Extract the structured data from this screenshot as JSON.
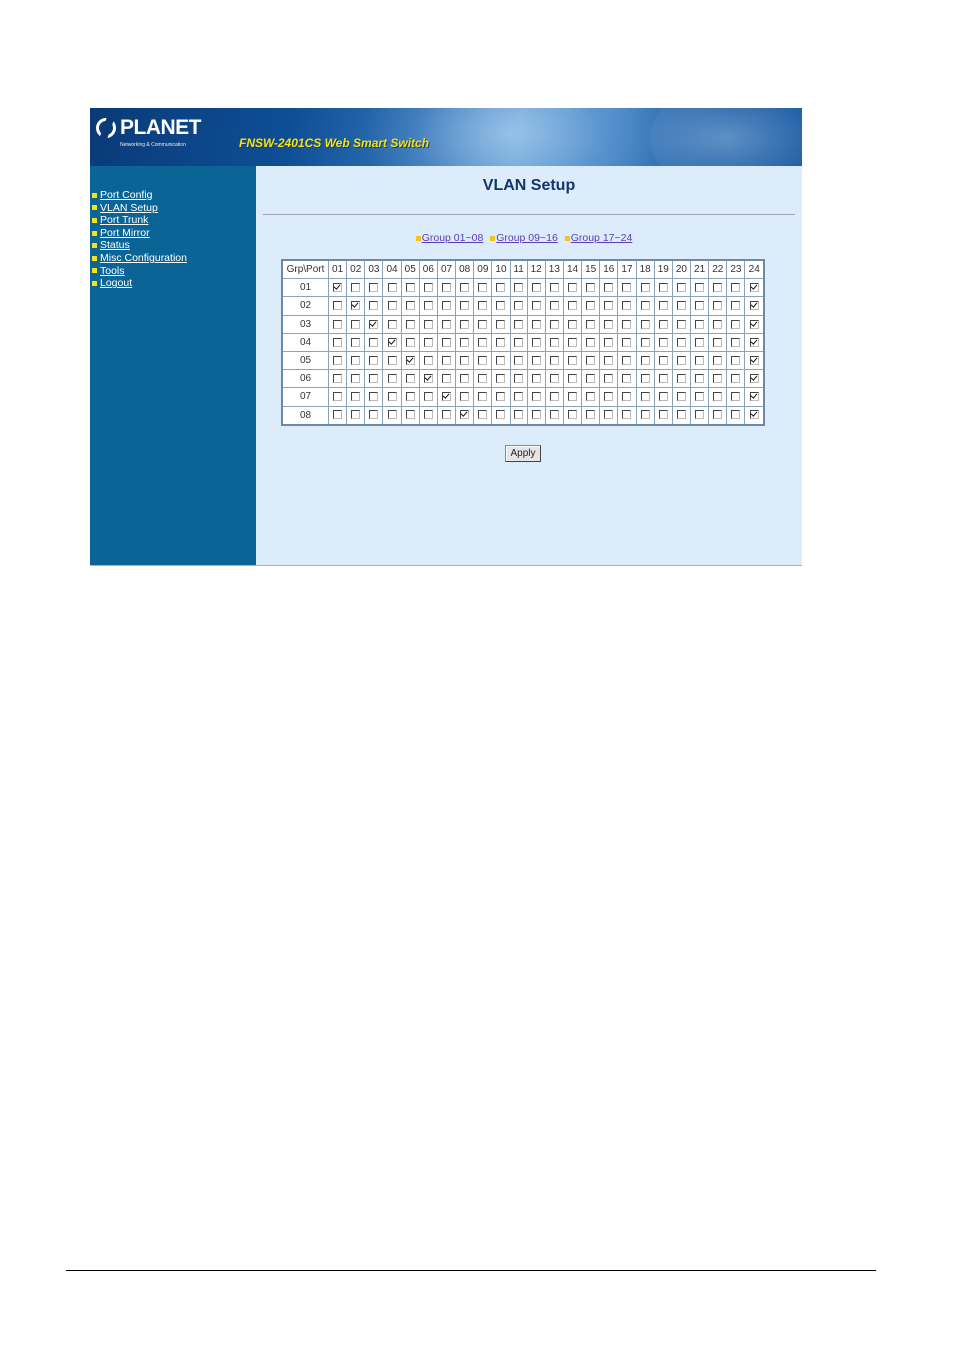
{
  "header": {
    "logo_text": "PLANET",
    "logo_tagline": "Networking & Communication",
    "product_title": "FNSW-2401CS Web Smart Switch"
  },
  "sidebar": {
    "items": [
      {
        "label": "Port Config"
      },
      {
        "label": "VLAN Setup"
      },
      {
        "label": "Port Trunk"
      },
      {
        "label": "Port Mirror"
      },
      {
        "label": "Status"
      },
      {
        "label": "Misc Configuration"
      },
      {
        "label": "Tools"
      },
      {
        "label": "Logout"
      }
    ]
  },
  "main": {
    "title": "VLAN Setup",
    "group_links": [
      {
        "label": "Group 01~08"
      },
      {
        "label": "Group 09~16"
      },
      {
        "label": "Group 17~24"
      }
    ],
    "table": {
      "corner_header": "Grp\\Port",
      "ports": [
        "01",
        "02",
        "03",
        "04",
        "05",
        "06",
        "07",
        "08",
        "09",
        "10",
        "11",
        "12",
        "13",
        "14",
        "15",
        "16",
        "17",
        "18",
        "19",
        "20",
        "21",
        "22",
        "23",
        "24"
      ],
      "groups": [
        {
          "label": "01",
          "checked": [
            "01",
            "24"
          ]
        },
        {
          "label": "02",
          "checked": [
            "02",
            "24"
          ]
        },
        {
          "label": "03",
          "checked": [
            "03",
            "24"
          ]
        },
        {
          "label": "04",
          "checked": [
            "04",
            "24"
          ]
        },
        {
          "label": "05",
          "checked": [
            "05",
            "24"
          ]
        },
        {
          "label": "06",
          "checked": [
            "06",
            "24"
          ]
        },
        {
          "label": "07",
          "checked": [
            "07",
            "24"
          ]
        },
        {
          "label": "08",
          "checked": [
            "08",
            "24"
          ]
        }
      ]
    },
    "apply_label": "Apply"
  },
  "colors": {
    "sidebar_bg": "#0a6596",
    "content_bg": "#dcecfb",
    "title_color": "#12356e",
    "product_title_color": "#f2e21a",
    "bullet_yellow": "#f3e21b",
    "group_link_color": "#5a3dbb"
  }
}
